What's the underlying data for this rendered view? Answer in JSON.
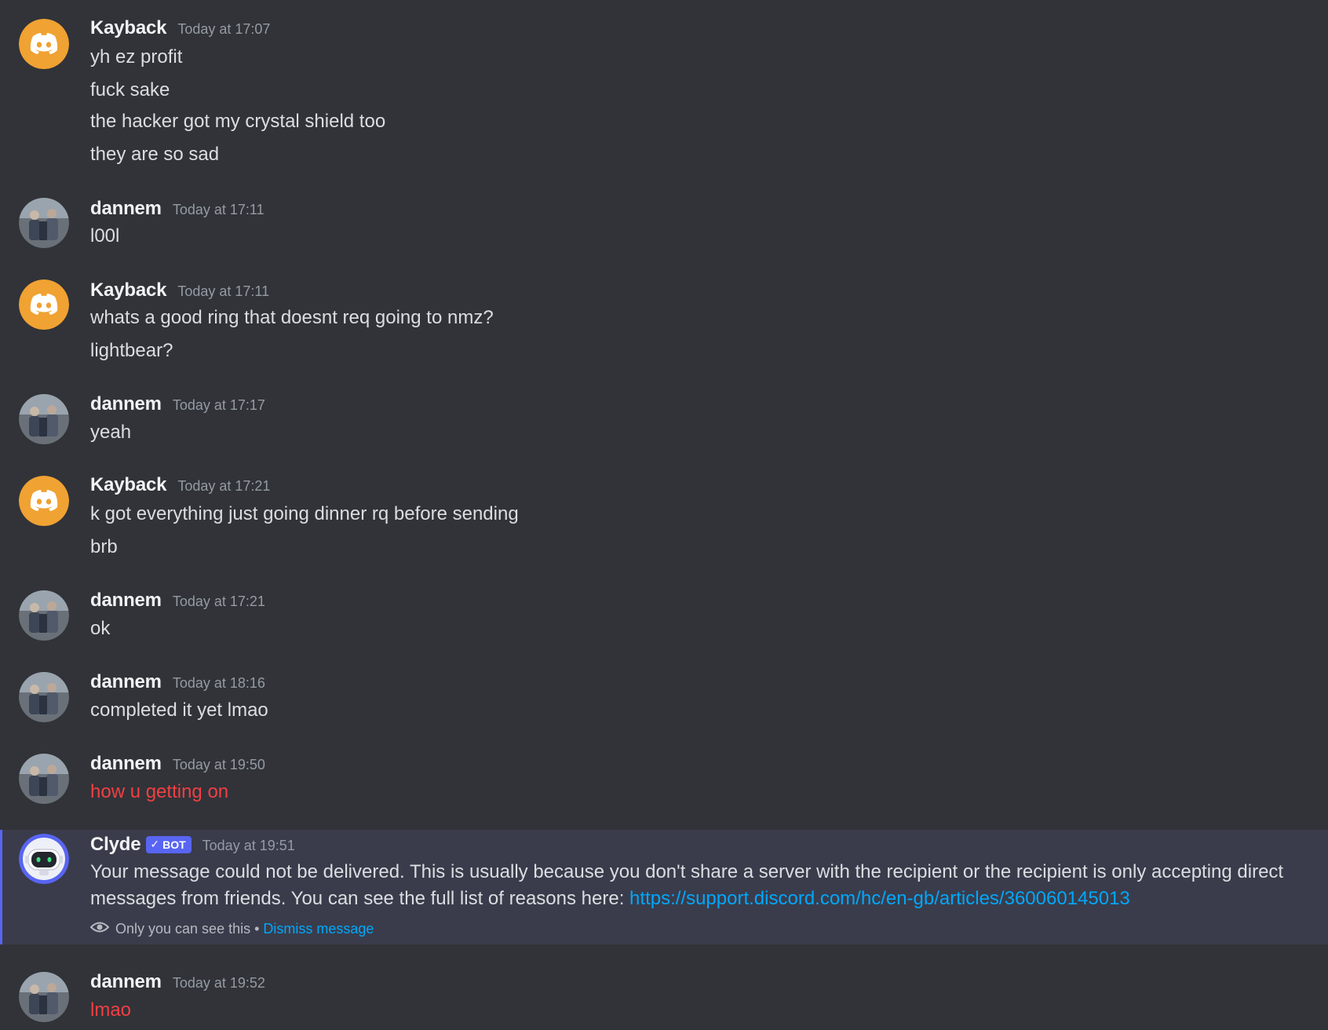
{
  "colors": {
    "background": "#313338",
    "kayback_avatar": "#f0a232",
    "failed_message": "#f23f43",
    "link": "#00a8fc",
    "bot_tag": "#5865f2"
  },
  "messages": [
    {
      "author": "Kayback",
      "timestamp": "Today at 17:07",
      "avatar_icon": "discord-logo-icon",
      "lines": [
        "yh ez profit",
        "fuck sake",
        "the hacker got my crystal shield too",
        "they are so sad"
      ]
    },
    {
      "author": "dannem",
      "timestamp": "Today at 17:11",
      "avatar_icon": "photo-avatar",
      "lines": [
        "l00l"
      ]
    },
    {
      "author": "Kayback",
      "timestamp": "Today at 17:11",
      "avatar_icon": "discord-logo-icon",
      "lines": [
        "whats a good ring that doesnt req going to nmz?",
        "lightbear?"
      ]
    },
    {
      "author": "dannem",
      "timestamp": "Today at 17:17",
      "avatar_icon": "photo-avatar",
      "lines": [
        "yeah"
      ]
    },
    {
      "author": "Kayback",
      "timestamp": "Today at 17:21",
      "avatar_icon": "discord-logo-icon",
      "lines": [
        "k got everything just going dinner rq before sending",
        "brb"
      ]
    },
    {
      "author": "dannem",
      "timestamp": "Today at 17:21",
      "avatar_icon": "photo-avatar",
      "lines": [
        "ok"
      ]
    },
    {
      "author": "dannem",
      "timestamp": "Today at 18:16",
      "avatar_icon": "photo-avatar",
      "lines": [
        "completed it yet lmao"
      ]
    },
    {
      "author": "dannem",
      "timestamp": "Today at 19:50",
      "avatar_icon": "photo-avatar",
      "lines": [
        "how u getting on"
      ],
      "failed": true
    },
    {
      "author": "dannem",
      "timestamp": "Today at 19:52",
      "avatar_icon": "photo-avatar",
      "lines": [
        "lmao"
      ],
      "failed": true
    }
  ],
  "clyde": {
    "author": "Clyde",
    "bot_tag": "BOT",
    "bot_check": "✓",
    "timestamp": "Today at 19:51",
    "avatar_icon": "clyde-robot-icon",
    "text": "Your message could not be delivered. This is usually because you don't share a server with the recipient or the recipient is only accepting direct messages from friends. You can see the full list of reasons here: ",
    "link": "https://support.discord.com/hc/en-gb/articles/360060145013",
    "ephemeral_note": "Only you can see this",
    "separator": "•",
    "dismiss_label": "Dismiss message"
  }
}
